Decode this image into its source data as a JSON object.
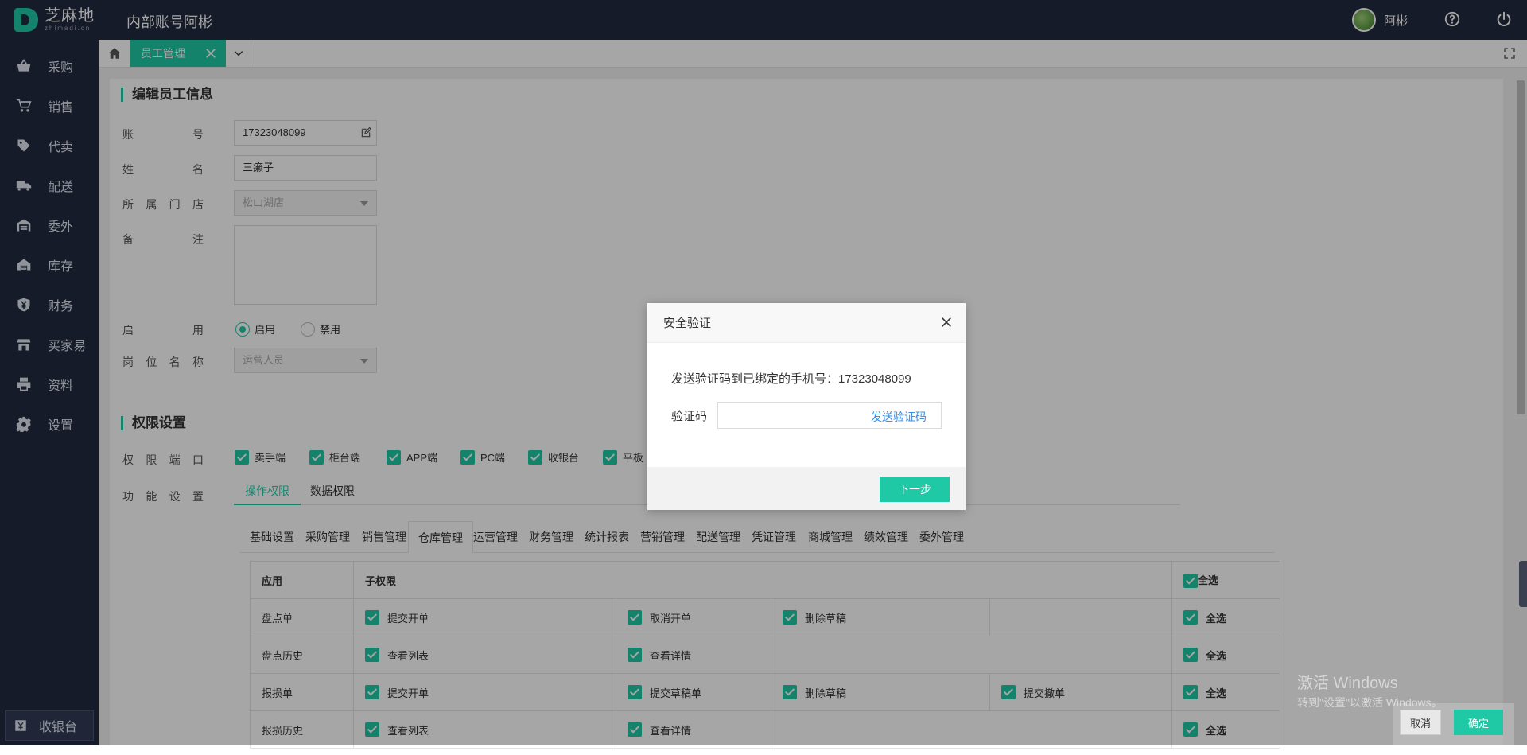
{
  "topbar": {
    "brand_cn": "芝麻地",
    "brand_en": "zhimadi.cn",
    "title": "内部账号阿彬",
    "user_name": "阿彬"
  },
  "sidebar": {
    "items": [
      {
        "label": "采购",
        "icon": "basket-icon"
      },
      {
        "label": "销售",
        "icon": "cart-icon"
      },
      {
        "label": "代卖",
        "icon": "tag-icon"
      },
      {
        "label": "配送",
        "icon": "truck-icon"
      },
      {
        "label": "委外",
        "icon": "warehouse-out-icon"
      },
      {
        "label": "库存",
        "icon": "warehouse-icon"
      },
      {
        "label": "财务",
        "icon": "yen-shield-icon"
      },
      {
        "label": "买家易",
        "icon": "store-icon"
      },
      {
        "label": "资料",
        "icon": "printer-icon"
      },
      {
        "label": "设置",
        "icon": "gear-icon"
      }
    ],
    "cashier": "收银台"
  },
  "tabs": {
    "active": "员工管理"
  },
  "form": {
    "title": "编辑员工信息",
    "account_label": "账号",
    "account_value": "17323048099",
    "name_label": "姓名",
    "name_value": "三癞子",
    "store_label": "所属门店",
    "store_value": "松山湖店",
    "remark_label": "备注",
    "enable_label": "启用",
    "enable_on": "启用",
    "enable_off": "禁用",
    "position_label": "岗位名称",
    "position_value": "运营人员"
  },
  "permissions": {
    "title": "权限设置",
    "ports_label": "权限端口",
    "ports": [
      "卖手端",
      "柜台端",
      "APP端",
      "PC端",
      "收银台",
      "平板"
    ],
    "function_label": "功能设置",
    "perm_tabs": [
      "操作权限",
      "数据权限"
    ],
    "module_tabs": [
      "基础设置",
      "采购管理",
      "销售管理",
      "仓库管理",
      "运营管理",
      "财务管理",
      "统计报表",
      "营销管理",
      "配送管理",
      "凭证管理",
      "商城管理",
      "绩效管理",
      "委外管理"
    ],
    "active_module": "仓库管理",
    "table_headers": {
      "app": "应用",
      "sub": "子权限",
      "all": "全选"
    },
    "rows": [
      {
        "app": "盘点单",
        "perms": [
          "提交开单",
          "取消开单",
          "删除草稿",
          ""
        ]
      },
      {
        "app": "盘点历史",
        "perms": [
          "查看列表",
          "查看详情",
          "",
          ""
        ]
      },
      {
        "app": "报损单",
        "perms": [
          "提交开单",
          "提交草稿单",
          "删除草稿",
          "提交撤单"
        ]
      },
      {
        "app": "报损历史",
        "perms": [
          "查看列表",
          "查看详情",
          "",
          ""
        ]
      }
    ],
    "all_label": "全选"
  },
  "dialog": {
    "title": "安全验证",
    "message": "发送验证码到已绑定的手机号：17323048099",
    "code_label": "验证码",
    "send_code": "发送验证码",
    "next": "下一步"
  },
  "watermark": {
    "line1": "激活 Windows",
    "line2": "转到\"设置\"以激活 Windows。"
  },
  "footer": {
    "cancel": "取消",
    "confirm": "确定"
  },
  "colors": {
    "accent": "#20c9a6",
    "sidebar": "#222a40",
    "link": "#3a8ee6"
  }
}
